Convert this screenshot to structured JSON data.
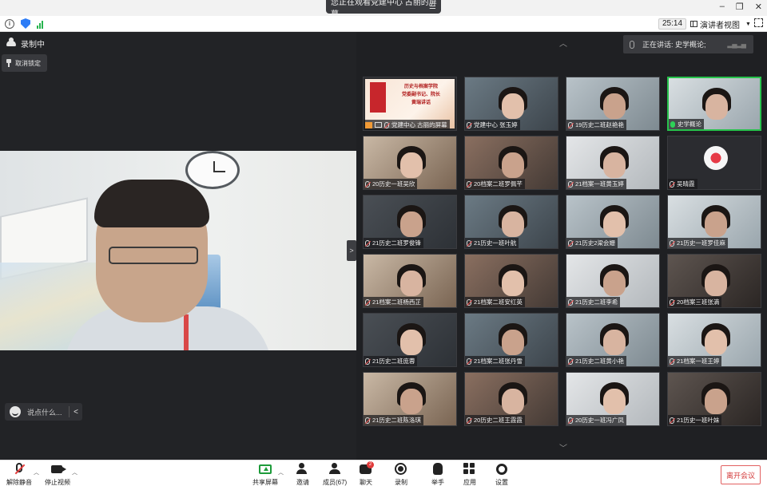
{
  "titlebar": {
    "title": "您正在观看党建中心 古丽的屏幕",
    "menu_icon": "menu-icon"
  },
  "statusbar": {
    "timer": "25:14",
    "view_label": "演讲者视图"
  },
  "main_left": {
    "recording_label": "录制中",
    "unpin_label": "取消锁定",
    "chat_placeholder": "说点什么..."
  },
  "speaking": {
    "label": "正在讲话: 史学概论;"
  },
  "participants": [
    {
      "name": "党建中心 古丽的屏幕",
      "kind": "screen"
    },
    {
      "name": "党建中心 张玉婷",
      "kind": "video"
    },
    {
      "name": "19历史二班赵艳艳",
      "kind": "video"
    },
    {
      "name": "史学概论",
      "kind": "video",
      "speaking": true
    },
    {
      "name": "20历史一班吴欣",
      "kind": "video"
    },
    {
      "name": "20档案二班罗佩芊",
      "kind": "video"
    },
    {
      "name": "21档案一班黄玉婷",
      "kind": "video"
    },
    {
      "name": "吴晴霞",
      "kind": "avatar"
    },
    {
      "name": "21历史二班罗俊锋",
      "kind": "video"
    },
    {
      "name": "21历史一班叶航",
      "kind": "video"
    },
    {
      "name": "21历史2梁会姗",
      "kind": "video"
    },
    {
      "name": "21历史一班罗佳麻",
      "kind": "video"
    },
    {
      "name": "21档案二班杨西芷",
      "kind": "video"
    },
    {
      "name": "21档案二班安红英",
      "kind": "video"
    },
    {
      "name": "21历史二班李希",
      "kind": "video"
    },
    {
      "name": "20档案三班张滴",
      "kind": "video"
    },
    {
      "name": "21历史二班庞蓉",
      "kind": "video"
    },
    {
      "name": "21档案二班张丹雪",
      "kind": "video"
    },
    {
      "name": "21历史二班黄小艳",
      "kind": "video"
    },
    {
      "name": "21档案一班王婷",
      "kind": "video"
    },
    {
      "name": "21历史二班陈洛琪",
      "kind": "video"
    },
    {
      "name": "20历史二班王霞霞",
      "kind": "video"
    },
    {
      "name": "20历史一班冯广凤",
      "kind": "video"
    },
    {
      "name": "21历史一班叶妹",
      "kind": "video"
    }
  ],
  "ppt_slide": {
    "line1": "历史与档案学院",
    "line2": "党委副书记、院长",
    "line3": "黄瑞讲话"
  },
  "toolbar": {
    "unmute_label": "解除静音",
    "stop_video_label": "停止视频",
    "share_label": "共享屏幕",
    "invite_label": "邀请",
    "members_label": "成员(67)",
    "chat_label": "聊天",
    "chat_badge": "2",
    "record_label": "录制",
    "raise_hand_label": "举手",
    "apps_label": "应用",
    "settings_label": "设置",
    "leave_label": "离开会议"
  },
  "colors": {
    "accent_green": "#27c24c",
    "leave_red": "#d33b3b",
    "dark_bg": "#1f2023"
  }
}
